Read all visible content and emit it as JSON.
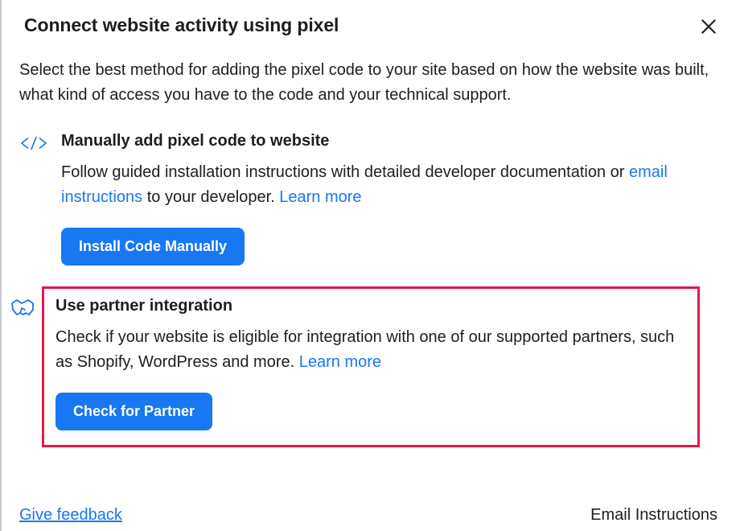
{
  "header": {
    "title": "Connect website activity using pixel"
  },
  "subtitle": "Select the best method for adding the pixel code to your site based on how the website was built, what kind of access you have to the code and your technical support.",
  "options": {
    "manual": {
      "title": "Manually add pixel code to website",
      "desc_prefix": "Follow guided installation instructions with detailed developer documentation or ",
      "email_link": "email instructions",
      "desc_mid": " to your developer. ",
      "learn_more": "Learn more",
      "button": "Install Code Manually"
    },
    "partner": {
      "title": "Use partner integration",
      "desc_prefix": "Check if your website is eligible for integration with one of our supported partners, such as Shopify, WordPress and more. ",
      "learn_more": "Learn more",
      "button": "Check for Partner"
    }
  },
  "footer": {
    "feedback": "Give feedback",
    "email": "Email Instructions"
  },
  "colors": {
    "primary": "#1877f2",
    "highlight": "#e6174b"
  }
}
